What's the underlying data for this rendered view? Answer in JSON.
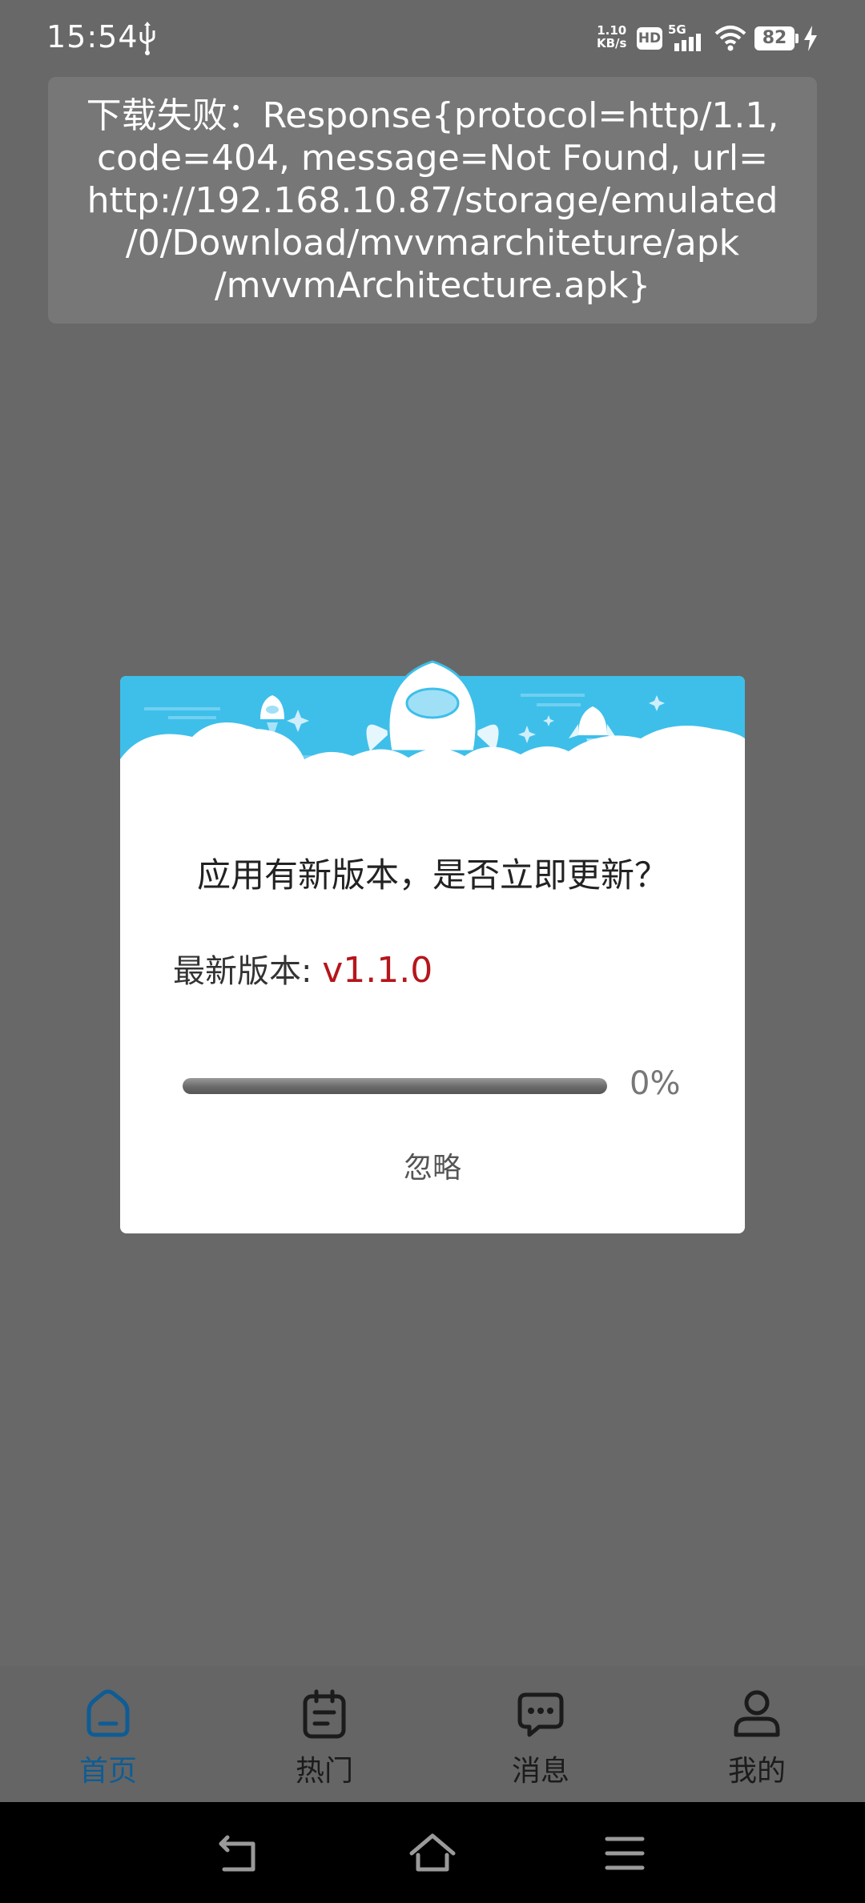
{
  "status_bar": {
    "time": "15:54",
    "net_speed_value": "1.10",
    "net_speed_unit": "KB/s",
    "hd_label": "HD",
    "network_type": "5G",
    "battery_level": "82",
    "icons": [
      "usb-icon",
      "hd-icon",
      "signal-icon",
      "wifi-icon",
      "battery-icon",
      "charging-icon"
    ]
  },
  "toast": {
    "lines": [
      "下载失败：Response{protocol=http/1.1,",
      "code=404, message=Not Found, url=",
      "http://192.168.10.87/storage/emulated",
      "/0/Download/mvvmarchiteture/apk",
      "/mvvmArchitecture.apk}"
    ]
  },
  "dialog": {
    "title": "应用有新版本，是否立即更新？",
    "version_label": "最新版本: ",
    "version_value": "v1.1.0",
    "progress": 0,
    "progress_text": "0%",
    "ignore_label": "忽略",
    "header_color": "#3dbfea",
    "version_color": "#b5161b"
  },
  "bottom_nav": {
    "items": [
      {
        "label": "首页",
        "icon": "home-icon",
        "active": true
      },
      {
        "label": "热门",
        "icon": "clipboard-icon",
        "active": false
      },
      {
        "label": "消息",
        "icon": "chat-icon",
        "active": false
      },
      {
        "label": "我的",
        "icon": "user-icon",
        "active": false
      }
    ],
    "active_color": "#0f5c94"
  },
  "system_nav": {
    "icons": [
      "back-icon",
      "home-icon",
      "menu-icon"
    ]
  }
}
